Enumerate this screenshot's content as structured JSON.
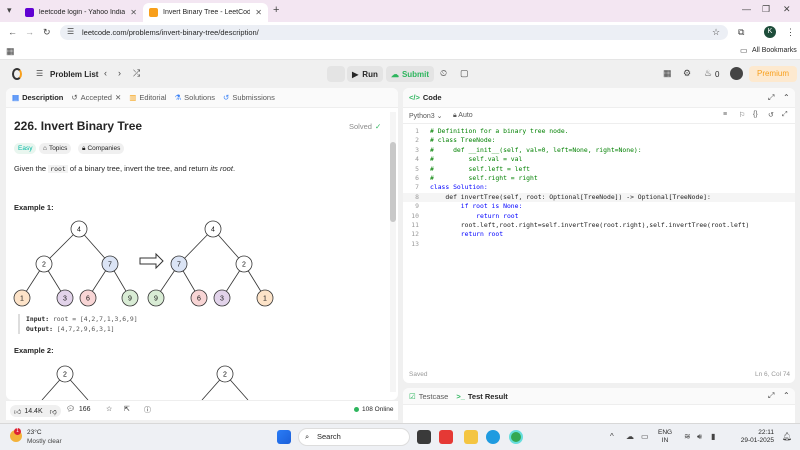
{
  "browser": {
    "tabs": [
      {
        "title": "leetcode login - Yahoo India Se"
      },
      {
        "title": "Invert Binary Tree - LeetCode"
      }
    ],
    "url": "leetcode.com/problems/invert-binary-tree/description/",
    "profile_initial": "K",
    "all_bookmarks": "All Bookmarks"
  },
  "nav": {
    "problem_list": "Problem List",
    "run": "Run",
    "submit": "Submit",
    "streak_count": "0",
    "premium": "Premium"
  },
  "left": {
    "tabs": [
      "Description",
      "Accepted",
      "Editorial",
      "Solutions",
      "Submissions"
    ],
    "title": "226. Invert Binary Tree",
    "solved": "Solved",
    "difficulty": "Easy",
    "topics": "Topics",
    "companies": "Companies",
    "desc_pre": "Given the ",
    "desc_code": "root",
    "desc_mid": " of a binary tree, invert the tree, and return ",
    "desc_em": "its root",
    "desc_end": ".",
    "example1": "Example 1:",
    "input_label": "Input:",
    "input_value": "root = [4,2,7,1,3,6,9]",
    "output_label": "Output:",
    "output_value": "[4,7,2,9,6,3,1]",
    "example2": "Example 2:",
    "tree1": [
      "4",
      "2",
      "7",
      "1",
      "3",
      "6",
      "9"
    ],
    "tree2": [
      "4",
      "7",
      "2",
      "9",
      "6",
      "3",
      "1"
    ],
    "tree3_root": "2",
    "tree4_root": "2",
    "likes": "14.4K",
    "comments": "166",
    "online": "108 Online"
  },
  "right": {
    "tab": "Code",
    "language": "Python3",
    "auto": "Auto",
    "status": "Saved",
    "cursor": "Ln 6, Col 74",
    "lines": [
      "# Definition for a binary tree node.",
      "# class TreeNode:",
      "#     def __init__(self, val=0, left=None, right=None):",
      "#         self.val = val",
      "#         self.left = left",
      "#         self.right = right",
      "class Solution:",
      "    def invertTree(self, root: Optional[TreeNode]) -> Optional[TreeNode]:",
      "        if root is None:",
      "            return root",
      "        root.left,root.right=self.invertTree(root.right),self.invertTree(root.left)",
      "        return root",
      ""
    ],
    "line_numbers": [
      "1",
      "2",
      "3",
      "4",
      "5",
      "6",
      "7",
      "8",
      "9",
      "10",
      "11",
      "12",
      "13"
    ],
    "testcase": "Testcase",
    "test_result": "Test Result"
  },
  "taskbar": {
    "temp": "23°C",
    "weather": "Mostly clear",
    "weather_badge": "1",
    "search": "Search",
    "lang1": "ENG",
    "lang2": "IN",
    "time": "22:11",
    "date": "29-01-2025"
  }
}
